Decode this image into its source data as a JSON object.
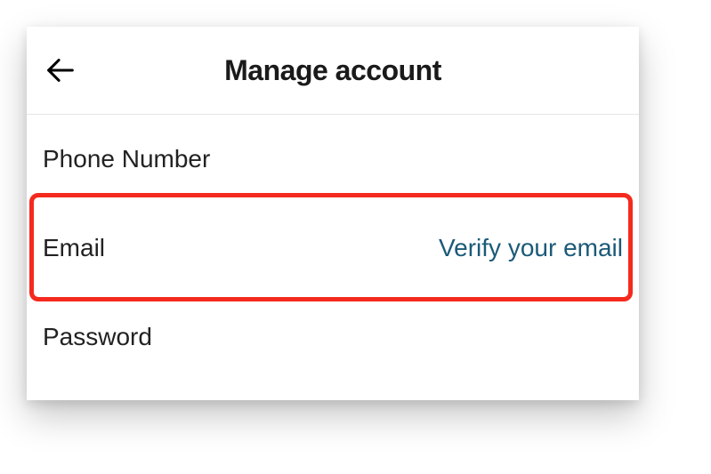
{
  "header": {
    "title": "Manage account"
  },
  "settings": {
    "phone": {
      "label": "Phone Number"
    },
    "email": {
      "label": "Email",
      "action": "Verify your email"
    },
    "password": {
      "label": "Password"
    }
  }
}
